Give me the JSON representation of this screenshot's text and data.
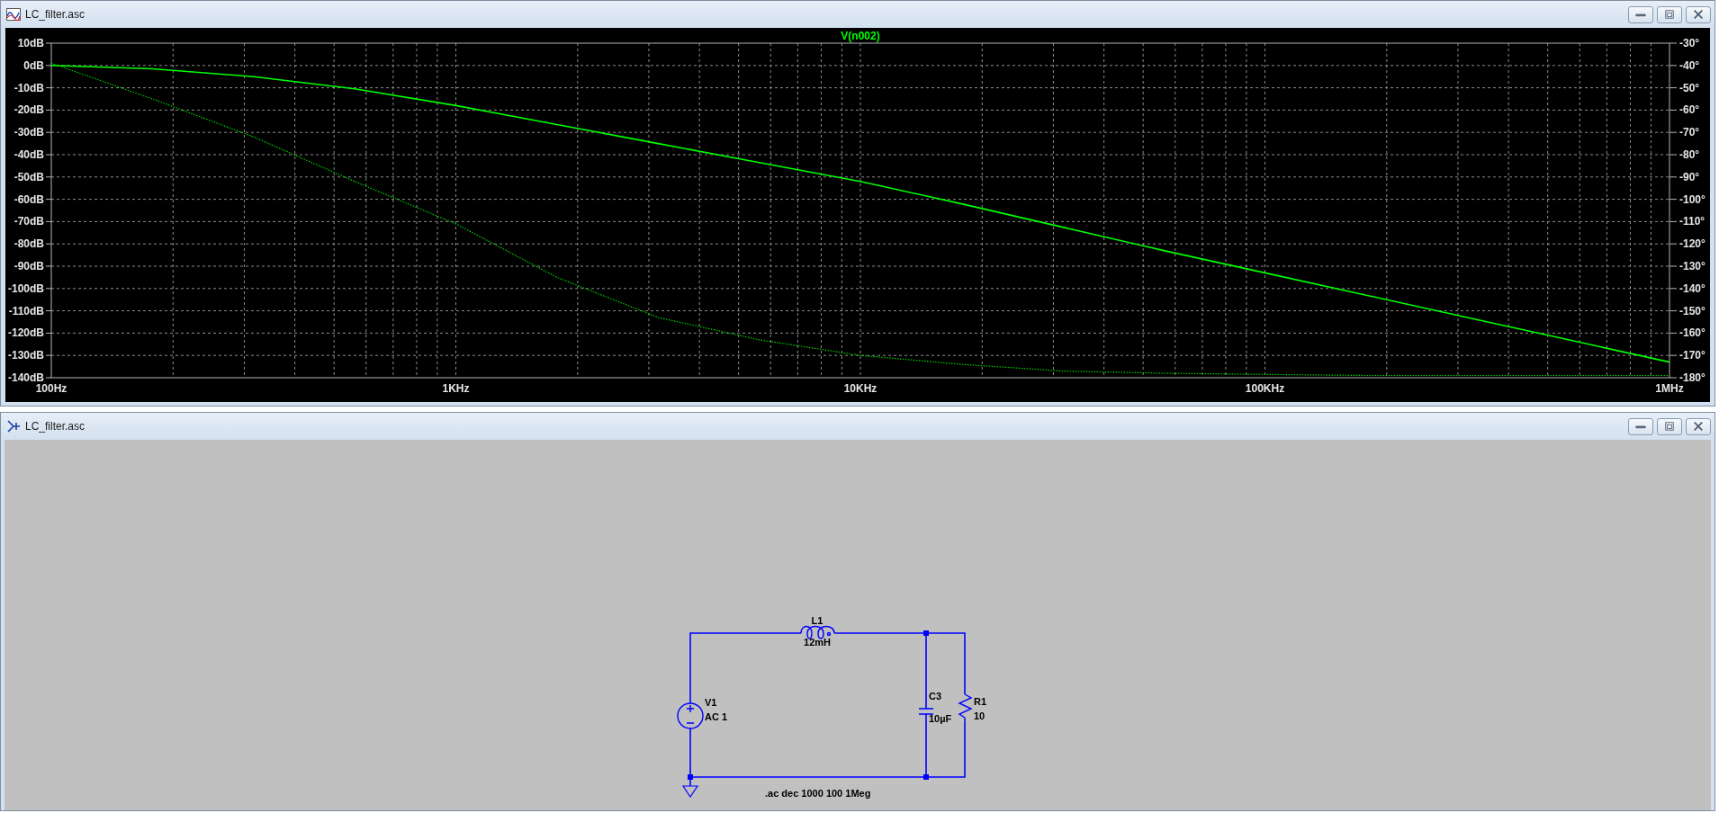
{
  "windows": [
    {
      "kind": "waveform",
      "title": "LC_filter.asc",
      "plot": {
        "chart_data": {
          "type": "line",
          "title": "V(n002)",
          "categories": [
            "100Hz",
            null,
            null,
            null,
            "1KHz",
            null,
            null,
            null,
            "10KHz",
            null,
            null,
            null,
            "100KHz",
            null,
            null,
            null,
            "1MHz"
          ],
          "series": [
            {
              "color": "#00ff00",
              "values": [
                0,
                -1.5,
                -5,
                -10.5,
                -18,
                -26.5,
                -35,
                -43.5,
                -52,
                -62,
                -72.5,
                -83,
                -93,
                -103,
                -113,
                -123,
                -133
              ]
            },
            {
              "color": "#00d000",
              "axis": "y2",
              "line_style": "dotted",
              "values": [
                -39,
                -55,
                -72,
                -92,
                -111,
                -135,
                -153,
                -163,
                -170,
                -174,
                -177,
                -178,
                -178.5,
                -179,
                -179,
                -179,
                -179
              ]
            }
          ],
          "grid": true,
          "ylim": [
            -140,
            10
          ],
          "y2lim": [
            -180,
            -30
          ],
          "yticks": [
            {
              "value": 10,
              "label": "10dB"
            },
            {
              "value": 0,
              "label": "0dB"
            },
            {
              "value": -10,
              "label": "-10dB"
            },
            {
              "value": -20,
              "label": "-20dB"
            },
            {
              "value": -30,
              "label": "-30dB"
            },
            {
              "value": -40,
              "label": "-40dB"
            },
            {
              "value": -50,
              "label": "-50dB"
            },
            {
              "value": -60,
              "label": "-60dB"
            },
            {
              "value": -70,
              "label": "-70dB"
            },
            {
              "value": -80,
              "label": "-80dB"
            },
            {
              "value": -90,
              "label": "-90dB"
            },
            {
              "value": -100,
              "label": "-100dB"
            },
            {
              "value": -110,
              "label": "-110dB"
            },
            {
              "value": -120,
              "label": "-120dB"
            },
            {
              "value": -130,
              "label": "-130dB"
            },
            {
              "value": -140,
              "label": "-140dB"
            }
          ],
          "y2ticks": [
            {
              "value": -30,
              "label": "-30°"
            },
            {
              "value": -40,
              "label": "-40°"
            },
            {
              "value": -50,
              "label": "-50°"
            },
            {
              "value": -60,
              "label": "-60°"
            },
            {
              "value": -70,
              "label": "-70°"
            },
            {
              "value": -80,
              "label": "-80°"
            },
            {
              "value": -90,
              "label": "-90°"
            },
            {
              "value": -100,
              "label": "-100°"
            },
            {
              "value": -110,
              "label": "-110°"
            },
            {
              "value": -120,
              "label": "-120°"
            },
            {
              "value": -130,
              "label": "-130°"
            },
            {
              "value": -140,
              "label": "-140°"
            },
            {
              "value": -150,
              "label": "-150°"
            },
            {
              "value": -160,
              "label": "-160°"
            },
            {
              "value": -170,
              "label": "-170°"
            },
            {
              "value": -180,
              "label": "-180°"
            }
          ]
        }
      }
    },
    {
      "kind": "schematic",
      "title": "LC_filter.asc",
      "schematic": {
        "components": [
          {
            "kind": "voltage_source",
            "name": "V1",
            "value": "AC 1"
          },
          {
            "kind": "inductor",
            "name": "L1",
            "value": "12mH"
          },
          {
            "kind": "capacitor",
            "name": "C3",
            "value": "10µF"
          },
          {
            "kind": "resistor",
            "name": "R1",
            "value": "10"
          }
        ],
        "directive": ".ac dec 1000 100 1Meg"
      }
    }
  ]
}
